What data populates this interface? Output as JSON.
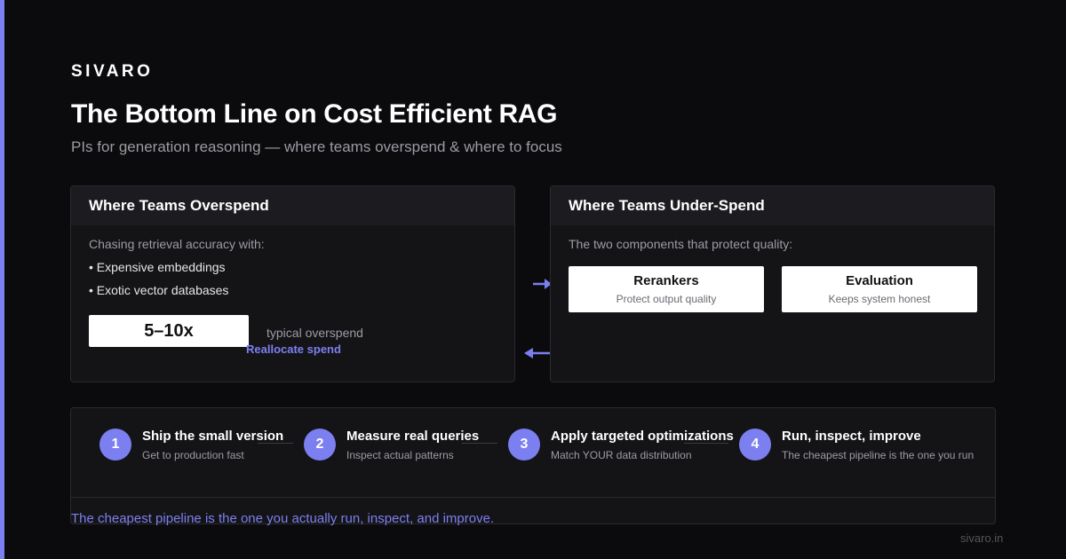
{
  "colors": {
    "background": "#0b0b0d",
    "accent": "#7c7ff0",
    "panel": "#141417",
    "panel_header": "#1c1c20",
    "muted_text": "#9b9ba3"
  },
  "brand": "SIVARO",
  "title": "The Bottom Line on Cost Efficient RAG",
  "subtitle": "PIs for generation reasoning — where teams overspend & where to focus",
  "overspend": {
    "header": "Where Teams Overspend",
    "intro": "Chasing retrieval accuracy with:",
    "bullets": [
      "• Expensive embeddings",
      "• Exotic vector databases"
    ],
    "metric": "5–10x",
    "metric_note": "typical overspend"
  },
  "flow": {
    "reallocate_label": "Reallocate spend",
    "right_arrow_icon": "arrow-right-icon",
    "left_arrow_icon": "arrow-left-icon"
  },
  "underspend": {
    "header": "Where Teams Under-Spend",
    "intro": "The two components that protect quality:",
    "cards": [
      {
        "title": "Rerankers",
        "sub": "Protect output quality"
      },
      {
        "title": "Evaluation",
        "sub": "Keeps system honest"
      }
    ]
  },
  "steps": [
    {
      "num": "1",
      "title": "Ship the small version",
      "sub": "Get to production fast"
    },
    {
      "num": "2",
      "title": "Measure real queries",
      "sub": "Inspect actual patterns"
    },
    {
      "num": "3",
      "title": "Apply targeted optimizations",
      "sub": "Match YOUR data distribution"
    },
    {
      "num": "4",
      "title": "Run, inspect, improve",
      "sub": "The cheapest pipeline is the one you run"
    }
  ],
  "bottom_line": "The cheapest pipeline is the one you actually run, inspect, and improve.",
  "footer_url": "sivaro.in"
}
